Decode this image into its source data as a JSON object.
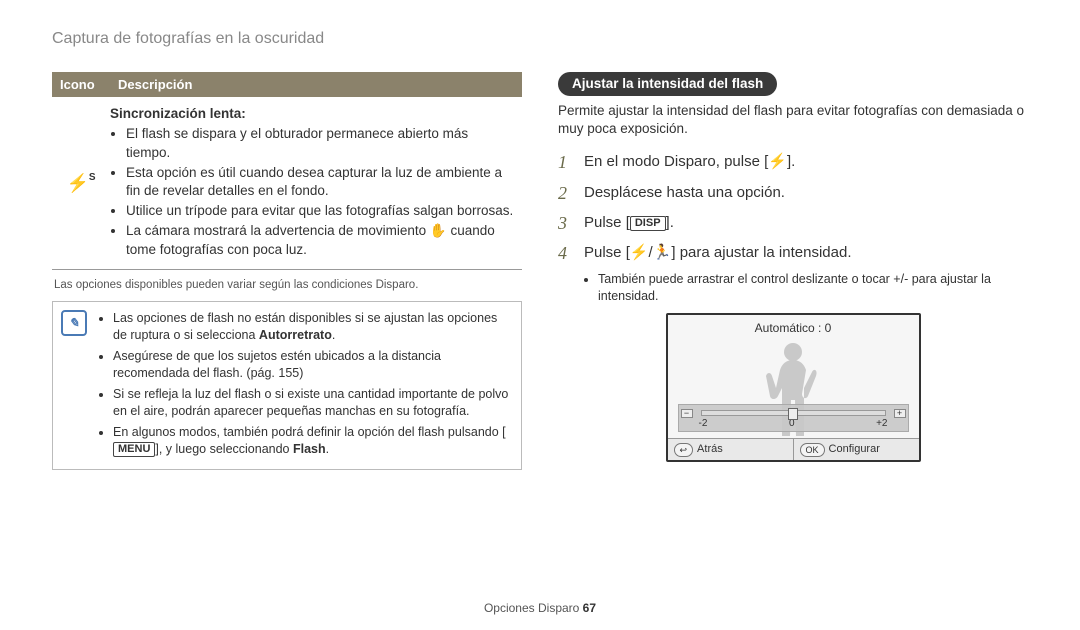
{
  "page_title": "Captura de fotografías en la oscuridad",
  "table": {
    "head_icon": "Icono",
    "head_desc": "Descripción",
    "row_title": "Sincronización lenta",
    "bullets": [
      "El flash se dispara y el obturador permanece abierto más tiempo.",
      "Esta opción es útil cuando desea capturar la luz de ambiente a fin de revelar detalles en el fondo.",
      "Utilice un trípode para evitar que las fotografías salgan borrosas.",
      "La cámara mostrará la advertencia de movimiento ✋ cuando tome fotografías con poca luz."
    ]
  },
  "small_note": "Las opciones disponibles pueden variar según las condiciones Disparo.",
  "info": {
    "b1a": "Las opciones de flash no están disponibles si se ajustan las opciones de ruptura o si selecciona ",
    "b1b": "Autorretrato",
    "b1c": ".",
    "b2": "Asegúrese de que los sujetos estén ubicados a la distancia recomendada del flash. (pág. 155)",
    "b3": "Si se refleja la luz del flash o si existe una cantidad importante de polvo en el aire, podrán aparecer pequeñas manchas en su fotografía.",
    "b4a": "En algunos modos, también podrá definir la opción del flash pulsando [",
    "b4key": "MENU",
    "b4b": "], y luego seleccionando ",
    "b4c": "Flash",
    "b4d": "."
  },
  "right": {
    "pill": "Ajustar la intensidad del flash",
    "intro": "Permite ajustar la intensidad del flash para evitar fotografías con demasiada o muy poca exposición.",
    "step1": "En el modo Disparo, pulse [⚡].",
    "step2": "Desplácese hasta una opción.",
    "step3a": "Pulse [",
    "step3key": "DISP",
    "step3b": "].",
    "step4": "Pulse [⚡/🏃] para ajustar la intensidad.",
    "sub": "También puede arrastrar el control deslizante o tocar +/- para ajustar la intensidad."
  },
  "screen": {
    "title": "Automático : 0",
    "minus": "-2",
    "zero": "0",
    "plus": "+2",
    "back_btn": "↩",
    "back_label": "Atrás",
    "ok_btn": "OK",
    "ok_label": "Configurar"
  },
  "footer": {
    "label": "Opciones Disparo  ",
    "page": "67"
  }
}
